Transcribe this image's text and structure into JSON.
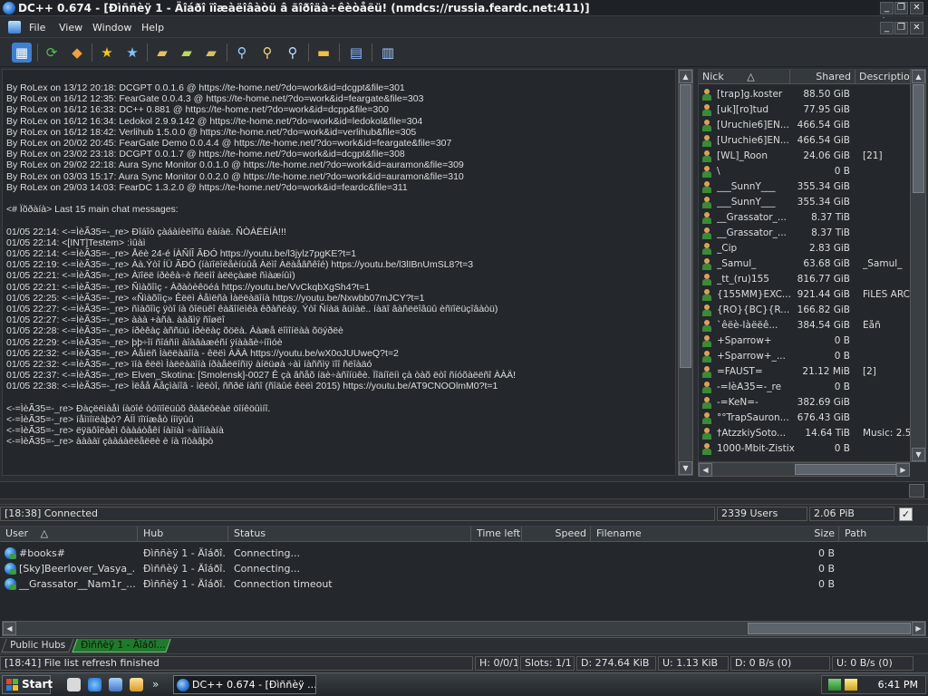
{
  "window": {
    "title": "DC++ 0.674 - [Đìññèÿ 1 - Äîáðî ïîæàëîâàòü â ãîðîäà÷êèòåëü! (nmdcs://russia.feardc.net:411)]",
    "minimize": "_",
    "restore": "❐",
    "close": "✕"
  },
  "menu": {
    "items": [
      "File",
      "View",
      "Window",
      "Help"
    ]
  },
  "toolbar": {
    "buttons": [
      "connect-icon",
      "reconnect-icon",
      "follow-redirect-icon",
      "favorite-hubs-icon",
      "favorite-users-icon",
      "download-queue-icon",
      "finished-downloads-icon",
      "waiting-users-icon",
      "search-icon",
      "adl-search-icon",
      "search-spy-icon",
      "open-file-list-icon",
      "settings-icon",
      "notepad-icon"
    ]
  },
  "chat": {
    "lines": [
      "By RoLex on 13/12 20:18: DCGPT 0.0.1.6 @ https://te-home.net/?do=work&id=dcgpt&file=301",
      "By RoLex on 16/12 12:35: FearGate 0.0.4.3 @ https://te-home.net/?do=work&id=feargate&file=303",
      "By RoLex on 16/12 16:33: DC++ 0.881 @ https://te-home.net/?do=work&id=dcpp&file=300",
      "By RoLex on 16/12 16:34: Ledokol 2.9.9.142 @ https://te-home.net/?do=work&id=ledokol&file=304",
      "By RoLex on 16/12 18:42: Verlihub 1.5.0.0 @ https://te-home.net/?do=work&id=verlihub&file=305",
      "By RoLex on 20/02 20:45: FearGate Demo 0.0.4.4 @ https://te-home.net/?do=work&id=feargate&file=307",
      "By RoLex on 23/02 23:18: DCGPT 0.0.1.7 @ https://te-home.net/?do=work&id=dcgpt&file=308",
      "By RoLex on 29/02 22:18: Aura Sync Monitor 0.0.1.0 @ https://te-home.net/?do=work&id=auramon&file=309",
      "By RoLex on 03/03 15:17: Aura Sync Monitor 0.0.2.0 @ https://te-home.net/?do=work&id=auramon&file=310",
      "By RoLex on 29/03 14:03: FearDC 1.3.2.0 @ https://te-home.net/?do=work&id=feardc&file=311",
      "",
      "<# Ïõðàíà> Last 15 main chat messages:",
      "",
      " 01/05 22:14: <-=ÌèÃ35=-_re> Ðîáîò çàáàíèëîñü êàíàë. ÑÒÀËÈÍÀ!!!",
      " 01/05 22:14: <[INT]Testem> :ìûàì",
      " 01/05 22:14: <-=ÌèÃ35=-_re> Åëè 24-é ÍÀÑÍÎ ÃÐÓ https://youtu.be/l3jylz7pgKE?t=1",
      " 01/05 22:19: <-=ÌèÃ35=-_re> Àà.Ýòî ÍÜ ÃÐÓ (íàïîëîëåèíüûå Àëìî Àëàåâñêîé) https://youtu.be/l3lIBnUmSL8?t=3",
      " 01/05 22:21: <-=ÌèÃ35=-_re> Àïîëë íðèêà÷è ñëëìî àëëçàæë ñìàæíûì)",
      " 01/05 22:21: <-=ÌèÃ35=-_re> Ñìàõîìç - Àðàòèêöéá https://youtu.be/VvCkqbXgSh4?t=1",
      " 01/05 22:25: <-=ÌèÃ35=-_re> «Ñìàõîìç» Êëëì Àåìëñà Ìàëëàäîíà https://youtu.be/Nxwbb07mJCY?t=1",
      " 01/05 22:27: <-=ÌèÃ35=-_re> ñìàõîìç ÿòî íà ôîëüêî êàãîíëìêà êðàñëàÿ. Ýòî Ñíàä âüìàë.. íàäî âàñëëîâüû èñïîëüçîâàòü)",
      " 01/05 22:27: <-=ÌèÃ35=-_re> ààà +àñà. ààãìÿ ñîøëî",
      " 01/05 22:28: <-=ÌèÃ35=-_re> íðèêàç àññüú íðèëàç õöëà. Ààæå ëîìîíëàà õöýðëè",
      " 01/05 22:29: <-=ÌèÃ35=-_re> þþ÷îí ñîáñíì àîàâàæéñí ÿíààãè÷íîìóè",
      " 01/05 22:32: <-=ÌèÃ35=-_re> Àåìëñ Ìàëëàäîíà - êëëì ÀÄÀ https://youtu.be/wX0oJUUweQ?t=2",
      " 01/05 22:32: <-=ÌèÃ35=-_re> ïíà êëëì Ìàëëàäîíà íðàåëëîñïÿ àíëüøà ÷àì íàññìÿ ïîî ñëîàäó",
      " 01/05 22:37: <-=ÌèÃ35=-_re> Elven_Skotina: [Smolensk]-0027 Ê çà âñåõ íäè÷àñîíüêè. Ïîäíîëíì çà òàõ ëòî ñíóõàëëñî ÀÀÄ!",
      " 01/05 22:38: <-=ÌèÃ35=-_re> Ìëåå Àåçìàíîâ - ìëëòî, ññðë íàñî (ñîäûé êëëì 2015) https://youtu.be/AT9CNOOlmM0?t=1",
      "",
      "<-=ÌèÃ35=-_re> Ðàçëëìàåì íàöîé òóïïîëüûõ ðàãëôëàë öîíêöûìíî.",
      "<-=ÌèÃ35=-_re> íåìïíïëàþò? ÀÍÌ ïîïíæåò ííïÿûû",
      "<-=ÌèÃ35=-_re> ëÿäôîëàêì ôààáòåêí íàìïàì ÷àìîíààíà",
      "<-=ÌèÃ35=-_re> ààààï çààáàëëåëëè è íà ïîòàâþò"
    ]
  },
  "users": {
    "headers": {
      "nick": "Nick",
      "sort": "△",
      "shared": "Shared",
      "description": "Description"
    },
    "rows": [
      {
        "nick": "[trap]g.koster",
        "shared": "88.50 GiB",
        "desc": ""
      },
      {
        "nick": "[uk][ro]tud",
        "shared": "77.95 GiB",
        "desc": ""
      },
      {
        "nick": "[Uruchie6]EN...",
        "shared": "466.54 GiB",
        "desc": ""
      },
      {
        "nick": "[Uruchie6]EN...",
        "shared": "466.54 GiB",
        "desc": ""
      },
      {
        "nick": "[WL]_Roon",
        "shared": "24.06 GiB",
        "desc": "[21]"
      },
      {
        "nick": "\\",
        "shared": "0 B",
        "desc": ""
      },
      {
        "nick": "___SunnY___",
        "shared": "355.34 GiB",
        "desc": ""
      },
      {
        "nick": "___SunnY___",
        "shared": "355.34 GiB",
        "desc": ""
      },
      {
        "nick": "__Grassator_...",
        "shared": "8.37 TiB",
        "desc": ""
      },
      {
        "nick": "__Grassator_...",
        "shared": "8.37 TiB",
        "desc": ""
      },
      {
        "nick": "_Cip",
        "shared": "2.83 GiB",
        "desc": ""
      },
      {
        "nick": "_Samul_",
        "shared": "63.68 GiB",
        "desc": "_Samul_"
      },
      {
        "nick": "_tt_(ru)155",
        "shared": "816.77 GiB",
        "desc": ""
      },
      {
        "nick": "{155MM}EXC...",
        "shared": "921.44 GiB",
        "desc": "FiLES ARC..."
      },
      {
        "nick": "{RO}{BC}{R...",
        "shared": "166.82 GiB",
        "desc": ""
      },
      {
        "nick": "`êëè-Ïàëëê...",
        "shared": "384.54 GiB",
        "desc": "Êåñ"
      },
      {
        "nick": "+Sparrow+",
        "shared": "0 B",
        "desc": ""
      },
      {
        "nick": "+Sparrow+_...",
        "shared": "0 B",
        "desc": ""
      },
      {
        "nick": "=FAUST=",
        "shared": "21.12 MiB",
        "desc": "[2]"
      },
      {
        "nick": "-=ÌèÃ35=-_re",
        "shared": "0 B",
        "desc": ""
      },
      {
        "nick": "-=KeN=-",
        "shared": "382.69 GiB",
        "desc": ""
      },
      {
        "nick": "°°TrapSauron...",
        "shared": "676.43 GiB",
        "desc": ""
      },
      {
        "nick": "†AtzzkiySoto...",
        "shared": "14.64 TiB",
        "desc": "Music: 2.5..."
      },
      {
        "nick": "1000-Mbit-Zistix",
        "shared": "0 B",
        "desc": ""
      }
    ]
  },
  "status": {
    "time_connected": "[18:38] Connected",
    "users": "2339 Users",
    "share": "2.06 PiB"
  },
  "transfers": {
    "headers": {
      "user": "User",
      "sort": "△",
      "hub": "Hub",
      "status": "Status",
      "time_left": "Time left",
      "speed": "Speed",
      "filename": "Filename",
      "size": "Size",
      "path": "Path"
    },
    "rows": [
      {
        "user": "#books#",
        "hub": "Đìññèÿ 1 - Äîáðî...",
        "status": "Connecting...",
        "size": "0 B"
      },
      {
        "user": "[Sky]Beerlover_Vasya_...",
        "hub": "Đìññèÿ 1 - Äîáðî...",
        "status": "Connecting...",
        "size": "0 B"
      },
      {
        "user": "__Grassator__Nam1r_...",
        "hub": "Đìññèÿ 1 - Äîáðî...",
        "status": "Connection timeout",
        "size": "0 B"
      }
    ]
  },
  "tabs": {
    "public_hubs": "Public Hubs",
    "hub": "Đìññèÿ 1 - Äîáðî..."
  },
  "status2": {
    "msg": "[18:41] File list refresh finished",
    "hubs": "H: 0/0/1",
    "slots": "Slots: 1/1",
    "down": "D: 274.64 KiB",
    "up": "U: 1.13 KiB",
    "dspeed": "D: 0 B/s (0)",
    "uspeed": "U: 0 B/s (0)"
  },
  "taskbar": {
    "start": "Start",
    "task": "DC++ 0.674 - [Đìññèÿ ...",
    "clock": "6:41 PM",
    "more": "»"
  },
  "colors": {
    "accent": "#2a6fd0",
    "tab_active": "#1f7a2b",
    "background": "#2b2f33"
  }
}
